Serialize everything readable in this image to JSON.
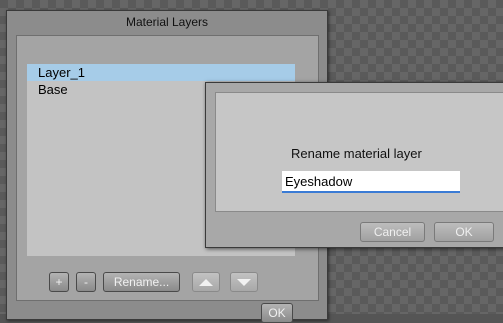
{
  "panel": {
    "title": "Material Layers",
    "layers": [
      {
        "label": "Layer_1",
        "selected": true
      },
      {
        "label": "Base",
        "selected": false
      }
    ],
    "buttons": {
      "add": "+",
      "remove": "-",
      "rename": "Rename...",
      "ok": "OK"
    }
  },
  "dialog": {
    "prompt": "Rename material layer",
    "input_value": "Eyeshadow",
    "cancel": "Cancel",
    "ok": "OK"
  },
  "colors": {
    "selection": "#a6cce8",
    "input_focus": "#3a7bd5"
  },
  "icons": [
    "move-up-icon",
    "move-down-icon"
  ]
}
